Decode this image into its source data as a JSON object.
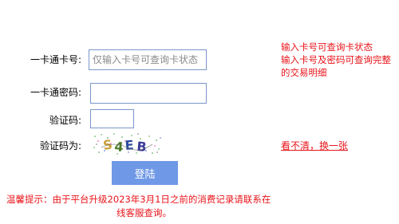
{
  "form": {
    "card_number_label": "一卡通卡号:",
    "card_number_placeholder": "仅输入卡号可查询卡状态",
    "card_number_value": "",
    "password_label": "一卡通密码:",
    "password_value": "",
    "captcha_label": "验证码:",
    "captcha_value": "",
    "captcha_image_label": "验证码为:",
    "captcha_text": "S4EB",
    "refresh_link": "看不清，换一张",
    "login_button": "登陆"
  },
  "hint": {
    "line1": "输入卡号可查询卡状态",
    "line2": "输入卡号及密码可查询完整",
    "line3": "的交易明细"
  },
  "notice": {
    "line1": "温馨提示：由于平台升级2023年3月1日之前的消费记录请联系在",
    "line2": "线客服查询。"
  },
  "colors": {
    "accent_red": "#e8141a",
    "button_blue": "#6f99e6",
    "input_border": "#7a96c8"
  }
}
